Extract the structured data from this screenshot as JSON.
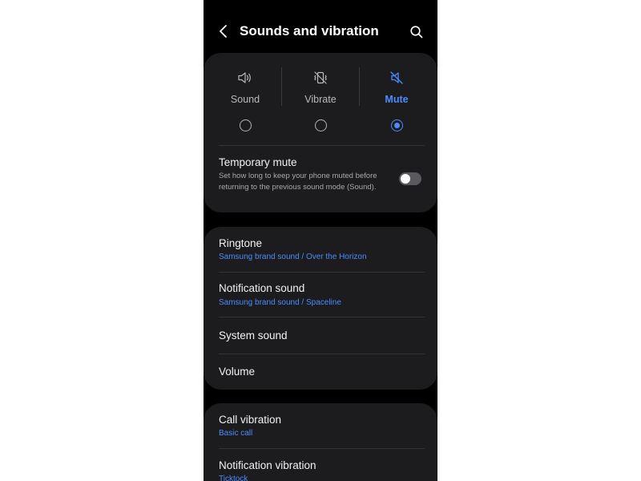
{
  "header": {
    "title": "Sounds and vibration",
    "back_icon": "back-arrow-icon",
    "search_icon": "search-icon"
  },
  "modes": [
    {
      "label": "Sound",
      "icon": "speaker-icon",
      "selected": false
    },
    {
      "label": "Vibrate",
      "icon": "vibrate-icon",
      "selected": false
    },
    {
      "label": "Mute",
      "icon": "mute-icon",
      "selected": true
    }
  ],
  "temporary_mute": {
    "title": "Temporary mute",
    "description": "Set how long to keep your phone muted before returning to the previous sound mode (Sound).",
    "enabled": false
  },
  "sound_settings": [
    {
      "title": "Ringtone",
      "subtitle": "Samsung brand sound / Over the Horizon"
    },
    {
      "title": "Notification sound",
      "subtitle": "Samsung brand sound / Spaceline"
    },
    {
      "title": "System sound",
      "subtitle": ""
    },
    {
      "title": "Volume",
      "subtitle": ""
    }
  ],
  "vibration_settings": [
    {
      "title": "Call vibration",
      "subtitle": "Basic call"
    },
    {
      "title": "Notification vibration",
      "subtitle": "Ticktock"
    }
  ],
  "colors": {
    "accent": "#4a8cff",
    "background": "#000000",
    "card": "#1c1c1e"
  }
}
